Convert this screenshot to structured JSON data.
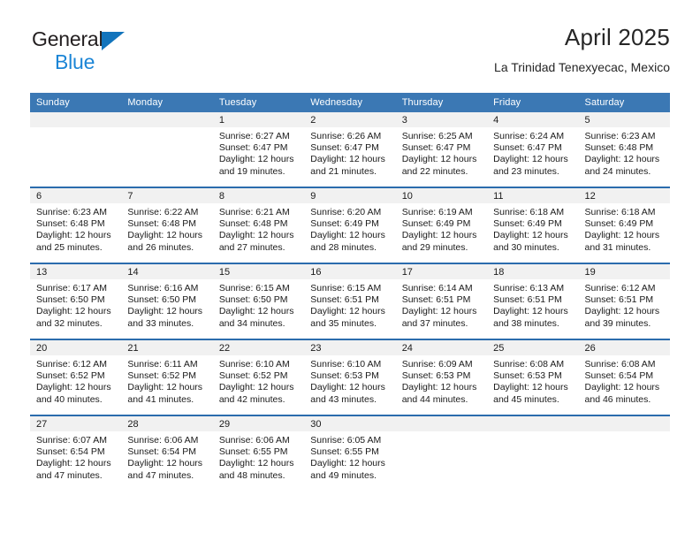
{
  "brand": {
    "name_top": "General",
    "name_bottom": "Blue",
    "triangle_color": "#1274bc",
    "blue_text_color": "#1b85d6"
  },
  "header": {
    "title": "April 2025",
    "subtitle": "La Trinidad Tenexyecac, Mexico"
  },
  "theme": {
    "header_bar_color": "#3b78b4",
    "row_divider_color": "#2b6cad",
    "daynum_band_color": "#f1f1f1",
    "text_color": "#1a1a1a"
  },
  "calendar": {
    "weekday_headers": [
      "Sunday",
      "Monday",
      "Tuesday",
      "Wednesday",
      "Thursday",
      "Friday",
      "Saturday"
    ],
    "labels": {
      "sunrise": "Sunrise:",
      "sunset": "Sunset:",
      "daylight": "Daylight:"
    },
    "weeks": [
      [
        {
          "day": "",
          "empty": true
        },
        {
          "day": "",
          "empty": true
        },
        {
          "day": "1",
          "sunrise": "Sunrise: 6:27 AM",
          "sunset": "Sunset: 6:47 PM",
          "daylight": "Daylight: 12 hours and 19 minutes."
        },
        {
          "day": "2",
          "sunrise": "Sunrise: 6:26 AM",
          "sunset": "Sunset: 6:47 PM",
          "daylight": "Daylight: 12 hours and 21 minutes."
        },
        {
          "day": "3",
          "sunrise": "Sunrise: 6:25 AM",
          "sunset": "Sunset: 6:47 PM",
          "daylight": "Daylight: 12 hours and 22 minutes."
        },
        {
          "day": "4",
          "sunrise": "Sunrise: 6:24 AM",
          "sunset": "Sunset: 6:47 PM",
          "daylight": "Daylight: 12 hours and 23 minutes."
        },
        {
          "day": "5",
          "sunrise": "Sunrise: 6:23 AM",
          "sunset": "Sunset: 6:48 PM",
          "daylight": "Daylight: 12 hours and 24 minutes."
        }
      ],
      [
        {
          "day": "6",
          "sunrise": "Sunrise: 6:23 AM",
          "sunset": "Sunset: 6:48 PM",
          "daylight": "Daylight: 12 hours and 25 minutes."
        },
        {
          "day": "7",
          "sunrise": "Sunrise: 6:22 AM",
          "sunset": "Sunset: 6:48 PM",
          "daylight": "Daylight: 12 hours and 26 minutes."
        },
        {
          "day": "8",
          "sunrise": "Sunrise: 6:21 AM",
          "sunset": "Sunset: 6:48 PM",
          "daylight": "Daylight: 12 hours and 27 minutes."
        },
        {
          "day": "9",
          "sunrise": "Sunrise: 6:20 AM",
          "sunset": "Sunset: 6:49 PM",
          "daylight": "Daylight: 12 hours and 28 minutes."
        },
        {
          "day": "10",
          "sunrise": "Sunrise: 6:19 AM",
          "sunset": "Sunset: 6:49 PM",
          "daylight": "Daylight: 12 hours and 29 minutes."
        },
        {
          "day": "11",
          "sunrise": "Sunrise: 6:18 AM",
          "sunset": "Sunset: 6:49 PM",
          "daylight": "Daylight: 12 hours and 30 minutes."
        },
        {
          "day": "12",
          "sunrise": "Sunrise: 6:18 AM",
          "sunset": "Sunset: 6:49 PM",
          "daylight": "Daylight: 12 hours and 31 minutes."
        }
      ],
      [
        {
          "day": "13",
          "sunrise": "Sunrise: 6:17 AM",
          "sunset": "Sunset: 6:50 PM",
          "daylight": "Daylight: 12 hours and 32 minutes."
        },
        {
          "day": "14",
          "sunrise": "Sunrise: 6:16 AM",
          "sunset": "Sunset: 6:50 PM",
          "daylight": "Daylight: 12 hours and 33 minutes."
        },
        {
          "day": "15",
          "sunrise": "Sunrise: 6:15 AM",
          "sunset": "Sunset: 6:50 PM",
          "daylight": "Daylight: 12 hours and 34 minutes."
        },
        {
          "day": "16",
          "sunrise": "Sunrise: 6:15 AM",
          "sunset": "Sunset: 6:51 PM",
          "daylight": "Daylight: 12 hours and 35 minutes."
        },
        {
          "day": "17",
          "sunrise": "Sunrise: 6:14 AM",
          "sunset": "Sunset: 6:51 PM",
          "daylight": "Daylight: 12 hours and 37 minutes."
        },
        {
          "day": "18",
          "sunrise": "Sunrise: 6:13 AM",
          "sunset": "Sunset: 6:51 PM",
          "daylight": "Daylight: 12 hours and 38 minutes."
        },
        {
          "day": "19",
          "sunrise": "Sunrise: 6:12 AM",
          "sunset": "Sunset: 6:51 PM",
          "daylight": "Daylight: 12 hours and 39 minutes."
        }
      ],
      [
        {
          "day": "20",
          "sunrise": "Sunrise: 6:12 AM",
          "sunset": "Sunset: 6:52 PM",
          "daylight": "Daylight: 12 hours and 40 minutes."
        },
        {
          "day": "21",
          "sunrise": "Sunrise: 6:11 AM",
          "sunset": "Sunset: 6:52 PM",
          "daylight": "Daylight: 12 hours and 41 minutes."
        },
        {
          "day": "22",
          "sunrise": "Sunrise: 6:10 AM",
          "sunset": "Sunset: 6:52 PM",
          "daylight": "Daylight: 12 hours and 42 minutes."
        },
        {
          "day": "23",
          "sunrise": "Sunrise: 6:10 AM",
          "sunset": "Sunset: 6:53 PM",
          "daylight": "Daylight: 12 hours and 43 minutes."
        },
        {
          "day": "24",
          "sunrise": "Sunrise: 6:09 AM",
          "sunset": "Sunset: 6:53 PM",
          "daylight": "Daylight: 12 hours and 44 minutes."
        },
        {
          "day": "25",
          "sunrise": "Sunrise: 6:08 AM",
          "sunset": "Sunset: 6:53 PM",
          "daylight": "Daylight: 12 hours and 45 minutes."
        },
        {
          "day": "26",
          "sunrise": "Sunrise: 6:08 AM",
          "sunset": "Sunset: 6:54 PM",
          "daylight": "Daylight: 12 hours and 46 minutes."
        }
      ],
      [
        {
          "day": "27",
          "sunrise": "Sunrise: 6:07 AM",
          "sunset": "Sunset: 6:54 PM",
          "daylight": "Daylight: 12 hours and 47 minutes."
        },
        {
          "day": "28",
          "sunrise": "Sunrise: 6:06 AM",
          "sunset": "Sunset: 6:54 PM",
          "daylight": "Daylight: 12 hours and 47 minutes."
        },
        {
          "day": "29",
          "sunrise": "Sunrise: 6:06 AM",
          "sunset": "Sunset: 6:55 PM",
          "daylight": "Daylight: 12 hours and 48 minutes."
        },
        {
          "day": "30",
          "sunrise": "Sunrise: 6:05 AM",
          "sunset": "Sunset: 6:55 PM",
          "daylight": "Daylight: 12 hours and 49 minutes."
        },
        {
          "day": "",
          "empty": true
        },
        {
          "day": "",
          "empty": true
        },
        {
          "day": "",
          "empty": true
        }
      ]
    ]
  }
}
